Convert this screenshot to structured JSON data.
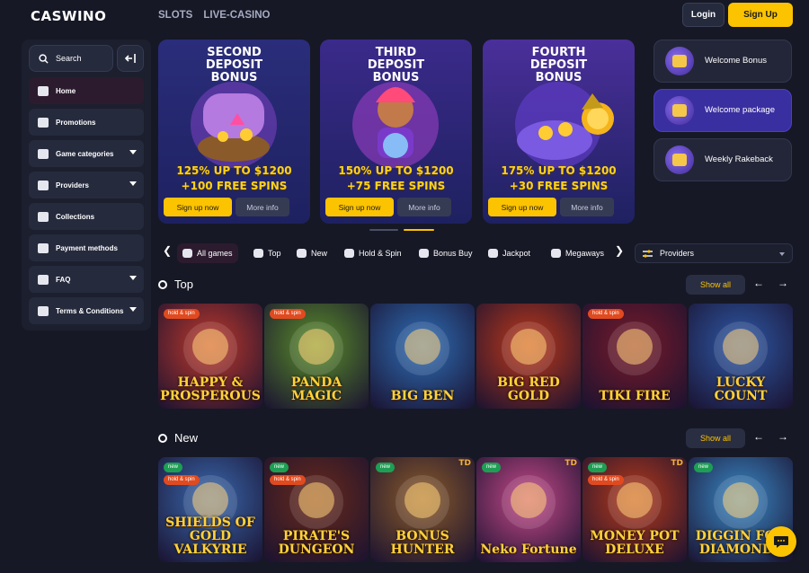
{
  "header": {
    "logo": "CASWINO",
    "nav": [
      "SLOTS",
      "LIVE-CASINO"
    ],
    "login_label": "Login",
    "signup_label": "Sign Up"
  },
  "sidebar": {
    "search_label": "Search",
    "items": [
      {
        "label": "Home",
        "icon": "home-icon",
        "active": true,
        "has_chevron": false
      },
      {
        "label": "Promotions",
        "icon": "gift-icon",
        "active": false,
        "has_chevron": false
      },
      {
        "label": "Game categories",
        "icon": "cards-icon",
        "active": false,
        "has_chevron": true
      },
      {
        "label": "Providers",
        "icon": "providers-icon",
        "active": false,
        "has_chevron": true
      },
      {
        "label": "Collections",
        "icon": "collections-icon",
        "active": false,
        "has_chevron": false
      },
      {
        "label": "Payment methods",
        "icon": "card-icon",
        "active": false,
        "has_chevron": false
      },
      {
        "label": "FAQ",
        "icon": "question-icon",
        "active": false,
        "has_chevron": true
      },
      {
        "label": "Terms & Conditions",
        "icon": "document-icon",
        "active": false,
        "has_chevron": true
      }
    ]
  },
  "promos": [
    {
      "title": "SECOND DEPOSIT BONUS",
      "offer_line1": "125% UP TO $1200",
      "offer_line2": "+100 FREE SPINS",
      "cta": "Sign up now",
      "more": "More info",
      "bg": "#2a2d7a"
    },
    {
      "title": "THIRD DEPOSIT BONUS",
      "offer_line1": "150% UP TO $1200",
      "offer_line2": "+75 FREE SPINS",
      "cta": "Sign up now",
      "more": "More info",
      "bg": "#3a2a8a"
    },
    {
      "title": "FOURTH DEPOSIT BONUS",
      "offer_line1": "175% UP TO $1200",
      "offer_line2": "+30 FREE SPINS",
      "cta": "Sign up now",
      "more": "More info",
      "bg": "#4a2f9a"
    }
  ],
  "bonus_buttons": [
    {
      "label": "Welcome Bonus",
      "icon": "gift-icon",
      "active": false
    },
    {
      "label": "Welcome package",
      "icon": "coin-icon",
      "active": true
    },
    {
      "label": "Weekly Rakeback",
      "icon": "crown-icon",
      "active": false
    }
  ],
  "filters": {
    "chips": [
      {
        "label": "All games",
        "icon": "all-games-icon",
        "active": true
      },
      {
        "label": "Top",
        "icon": "top-icon",
        "active": false
      },
      {
        "label": "New",
        "icon": "new-icon",
        "active": false
      },
      {
        "label": "Hold & Spin",
        "icon": "hold-spin-icon",
        "active": false
      },
      {
        "label": "Bonus Buy",
        "icon": "bonus-buy-icon",
        "active": false
      },
      {
        "label": "Jackpot",
        "icon": "jackpot-icon",
        "active": false
      },
      {
        "label": "Megaways",
        "icon": "megaways-icon",
        "active": false
      }
    ],
    "providers_label": "Providers"
  },
  "sections": [
    {
      "title": "Top",
      "show_all": "Show all",
      "games": [
        {
          "name": "HAPPY & PROSPEROUS",
          "badges": [
            "hold & spin"
          ],
          "td": false
        },
        {
          "name": "PANDA MAGIC",
          "badges": [
            "hold & spin"
          ],
          "td": false
        },
        {
          "name": "BIG BEN",
          "badges": [],
          "td": false
        },
        {
          "name": "BIG RED GOLD",
          "badges": [],
          "td": false
        },
        {
          "name": "TIKI FIRE",
          "badges": [
            "hold & spin"
          ],
          "td": false
        },
        {
          "name": "LUCKY COUNT",
          "badges": [],
          "td": false
        }
      ]
    },
    {
      "title": "New",
      "show_all": "Show all",
      "games": [
        {
          "name": "SHIELDS OF GOLD VALKYRIE",
          "badges": [
            "new",
            "hold & spin"
          ],
          "td": false
        },
        {
          "name": "PIRATE'S DUNGEON",
          "badges": [
            "new",
            "hold & spin"
          ],
          "td": false
        },
        {
          "name": "BONUS HUNTER",
          "badges": [
            "new"
          ],
          "td": true
        },
        {
          "name": "Neko Fortune",
          "badges": [
            "new"
          ],
          "td": true
        },
        {
          "name": "MONEY POT DELUXE",
          "badges": [
            "new",
            "hold & spin"
          ],
          "td": true
        },
        {
          "name": "DIGGIN FOR DIAMONDS",
          "badges": [
            "new"
          ],
          "td": false
        }
      ]
    }
  ],
  "td_label": "TD",
  "colors": {
    "accent": "#fcc300",
    "bg": "#161825",
    "panel": "#252a3d"
  }
}
